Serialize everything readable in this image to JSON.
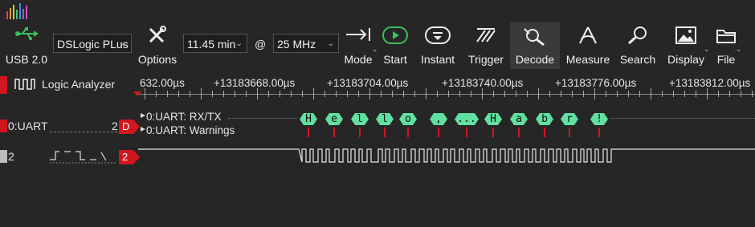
{
  "toolbar": {
    "usb": "USB 2.0",
    "device": "DSLogic PLus",
    "options": "Options",
    "duration": "11.45 min",
    "at": "@",
    "rate": "25 MHz",
    "mode": "Mode",
    "start": "Start",
    "instant": "Instant",
    "trigger": "Trigger",
    "decode": "Decode",
    "measure": "Measure",
    "search": "Search",
    "display": "Display",
    "file": "File"
  },
  "header": {
    "title": "Logic Analyzer",
    "ruler": [
      "632.00µs",
      "+13183668.00µs",
      "+13183704.00µs",
      "+13183740.00µs",
      "+13183776.00µs",
      "+13183812.00µs"
    ]
  },
  "channels": {
    "uart_label": "0:UART",
    "uart_num": "2",
    "uart_badge": "D",
    "decoder_rows": [
      "0:UART: RX/TX",
      "0:UART: Warnings"
    ],
    "ch2_label": "2",
    "ch2_badge": "2"
  },
  "decoded": [
    "H",
    "e",
    "l",
    "l",
    "o",
    ",",
    "...",
    "H",
    "a",
    "b",
    "r",
    "!"
  ],
  "colors": {
    "accent": "#d0161e",
    "decode": "#5fe0a0",
    "background": "#262626"
  }
}
